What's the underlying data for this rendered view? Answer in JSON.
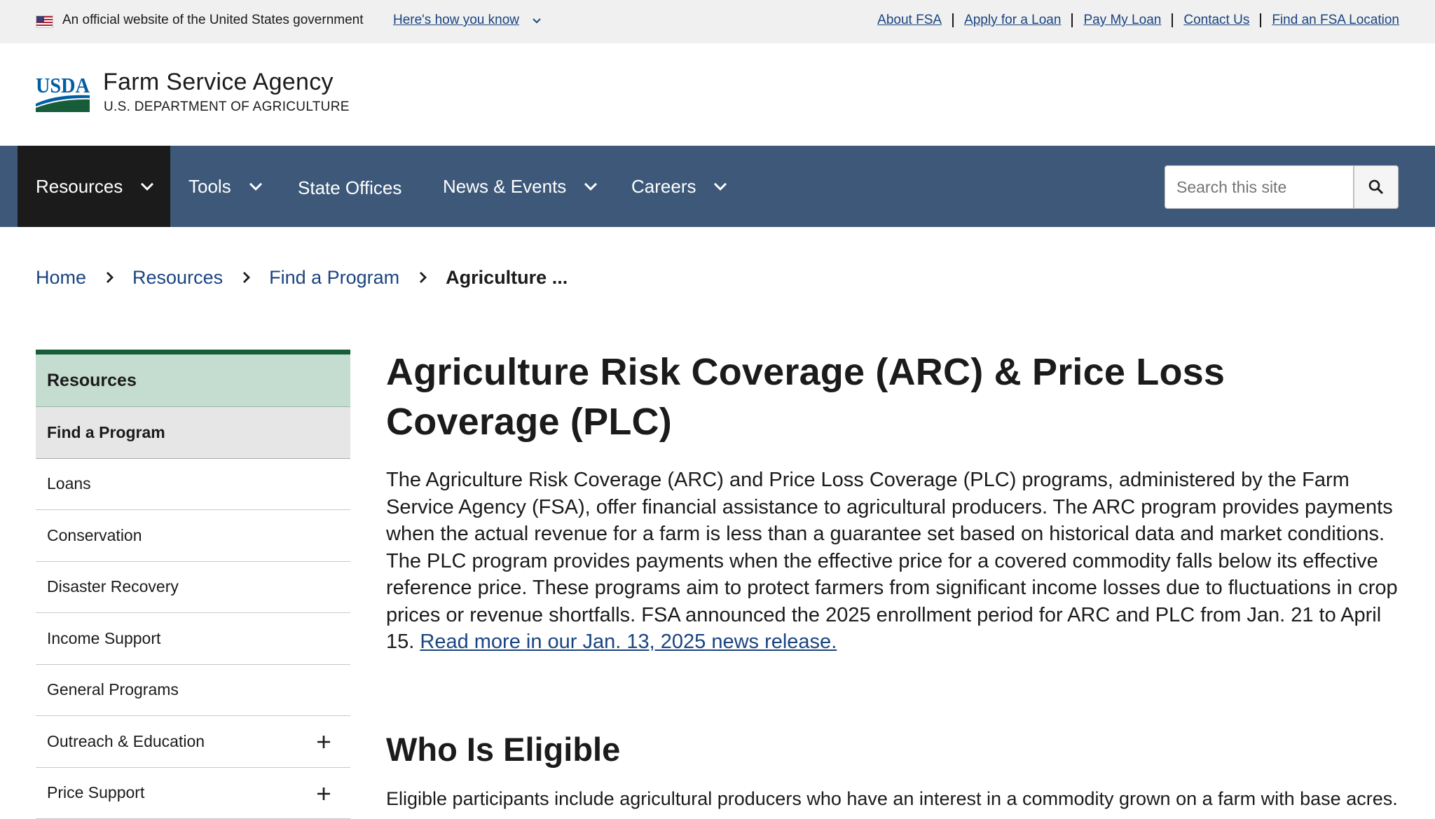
{
  "gov_banner": {
    "official_text": "An official website of the United States government",
    "how_you_know": "Here's how you know",
    "links": [
      "About FSA",
      "Apply for a Loan",
      "Pay My Loan",
      "Contact Us",
      "Find an FSA Location"
    ]
  },
  "header": {
    "agency_name": "Farm Service Agency",
    "department": "U.S. DEPARTMENT OF AGRICULTURE",
    "logo_text": "USDA"
  },
  "main_nav": {
    "items": [
      "Resources",
      "Tools",
      "State Offices",
      "News & Events",
      "Careers"
    ],
    "search_placeholder": "Search this site"
  },
  "breadcrumb": {
    "items": [
      "Home",
      "Resources",
      "Find a Program"
    ],
    "current": "Agriculture ..."
  },
  "sidenav": {
    "heading": "Resources",
    "items": [
      "Find a Program",
      "Loans",
      "Conservation",
      "Disaster Recovery",
      "Income Support",
      "General Programs",
      "Outreach & Education",
      "Price Support"
    ]
  },
  "content": {
    "title": "Agriculture Risk Coverage (ARC) & Price Loss Coverage (PLC)",
    "intro": "The Agriculture Risk Coverage (ARC) and Price Loss Coverage (PLC) programs, administered by the Farm Service Agency (FSA), offer financial assistance to agricultural producers. The ARC program provides payments when the actual revenue for a farm is less than a guarantee set based on historical data and market conditions. The PLC program provides payments when the effective price for a covered commodity falls below its effective reference price. These programs aim to protect farmers from significant income losses due to fluctuations in crop prices or revenue shortfalls. FSA announced the 2025 enrollment period for ARC and PLC from Jan. 21 to April 15.",
    "intro_link": "Read more in our Jan. 13, 2025 news release.",
    "eligible_heading": "Who Is Eligible",
    "eligible_text": "Eligible participants include agricultural producers who have an interest in a commodity grown on a farm with base acres."
  },
  "colors": {
    "nav_bg": "#3d5879",
    "link": "#1a4480",
    "sidenav_head_bg": "#c5dcd0",
    "sidenav_accent": "#175d3a"
  },
  "icons": [
    "us-flag-icon",
    "chevron-down-icon",
    "search-icon",
    "chevron-right-icon",
    "plus-icon",
    "usda-logo"
  ]
}
